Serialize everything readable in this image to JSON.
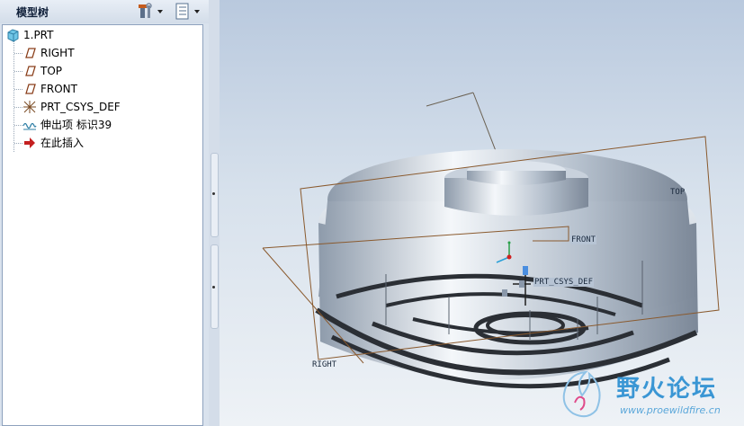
{
  "panel": {
    "title": "模型树",
    "tools_icon": "hammer-wrench-icon",
    "settings_icon": "tree-settings-icon",
    "dropdown_icon": "chevron-down-icon"
  },
  "tree": {
    "items": [
      {
        "label": "1.PRT",
        "icon": "part-icon"
      },
      {
        "label": "RIGHT",
        "icon": "datum-plane-icon"
      },
      {
        "label": "TOP",
        "icon": "datum-plane-icon"
      },
      {
        "label": "FRONT",
        "icon": "datum-plane-icon"
      },
      {
        "label": "PRT_CSYS_DEF",
        "icon": "coordinate-system-icon"
      },
      {
        "label": "伸出项 标识39",
        "icon": "extrude-feature-icon"
      },
      {
        "label": "在此插入",
        "icon": "insert-here-arrow-icon"
      }
    ]
  },
  "viewport": {
    "plane_labels": {
      "top": "TOP",
      "front": "FRONT",
      "right": "RIGHT"
    },
    "csys_label": "PRT_CSYS_DEF",
    "colors": {
      "datum_plane": "#8a5a2e",
      "body": "#a8b4c2",
      "background_top": "#b9c9de"
    }
  },
  "watermark": {
    "title": "野火论坛",
    "url": "www.proewildfire.cn"
  }
}
